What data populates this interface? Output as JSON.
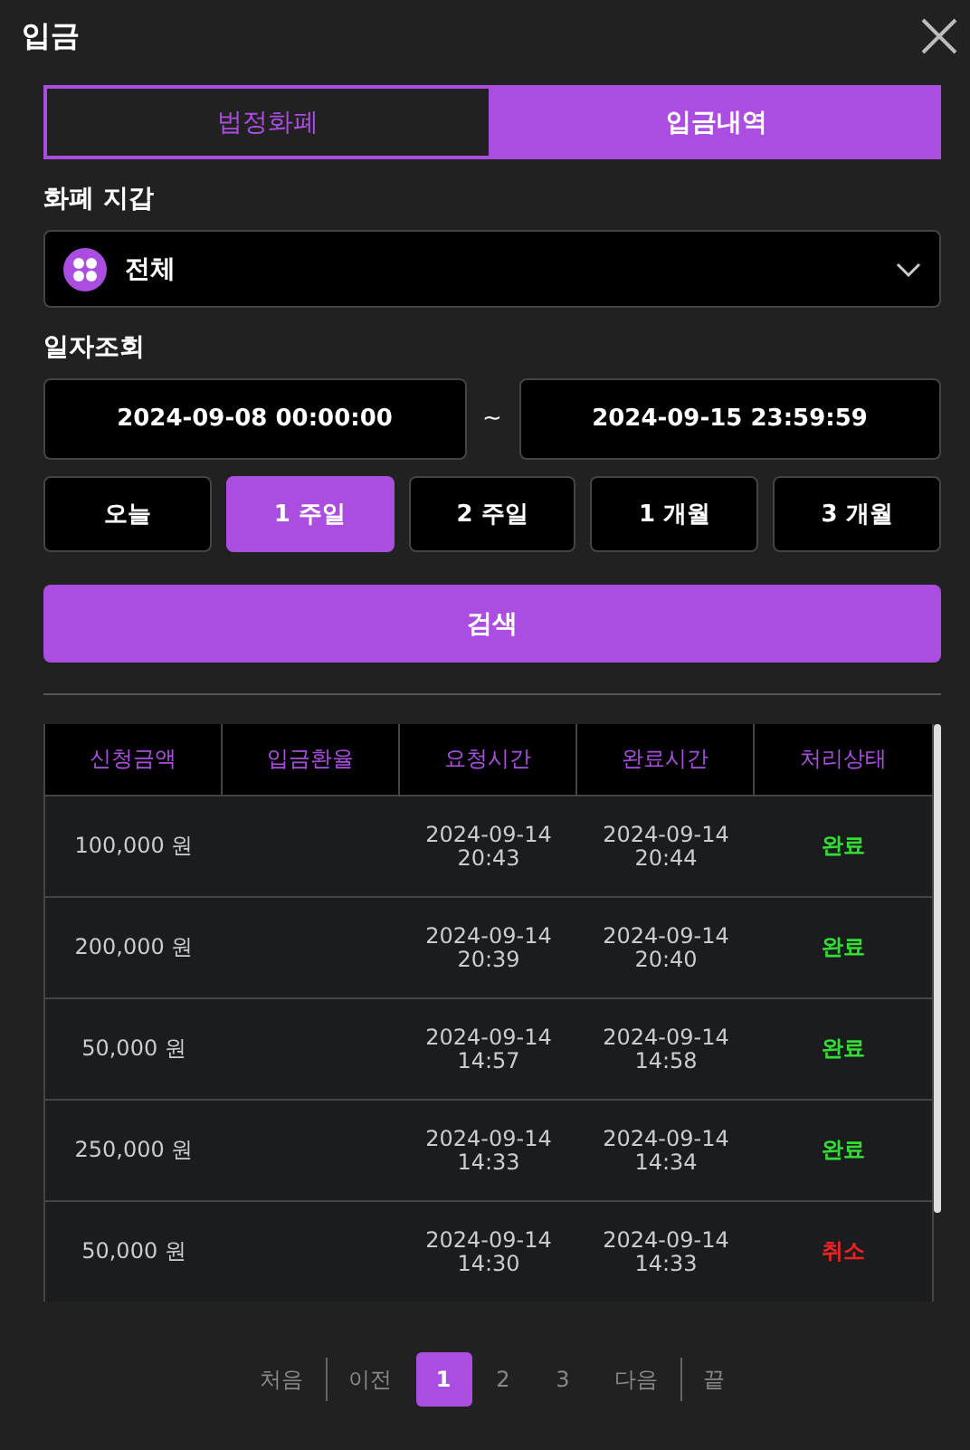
{
  "window": {
    "title": "입금"
  },
  "tabs": [
    {
      "label": "법정화폐",
      "selected": false
    },
    {
      "label": "입금내역",
      "selected": true
    }
  ],
  "wallet": {
    "label": "화폐 지갑",
    "value": "전체"
  },
  "date_filter": {
    "label": "일자조회",
    "from": "2024-09-08 00:00:00",
    "separator": "~",
    "to": "2024-09-15 23:59:59"
  },
  "periods": [
    {
      "label": "오늘",
      "selected": false
    },
    {
      "label": "1 주일",
      "selected": true
    },
    {
      "label": "2 주일",
      "selected": false
    },
    {
      "label": "1 개월",
      "selected": false
    },
    {
      "label": "3 개월",
      "selected": false
    }
  ],
  "search_button": "검색",
  "table": {
    "columns": [
      "신청금액",
      "입금환율",
      "요청시간",
      "완료시간",
      "처리상태"
    ],
    "rows": [
      {
        "amount": "100,000 원",
        "requested": [
          "2024-09-14",
          "20:43"
        ],
        "completed": [
          "2024-09-14",
          "20:44"
        ],
        "status": "완료",
        "color": "#33dd33"
      },
      {
        "amount": "200,000 원",
        "requested": [
          "2024-09-14",
          "20:39"
        ],
        "completed": [
          "2024-09-14",
          "20:40"
        ],
        "status": "완료",
        "color": "#33dd33"
      },
      {
        "amount": "50,000 원",
        "requested": [
          "2024-09-14",
          "14:57"
        ],
        "completed": [
          "2024-09-14",
          "14:58"
        ],
        "status": "완료",
        "color": "#33dd33"
      },
      {
        "amount": "250,000 원",
        "requested": [
          "2024-09-14",
          "14:33"
        ],
        "completed": [
          "2024-09-14",
          "14:34"
        ],
        "status": "완료",
        "color": "#33dd33"
      },
      {
        "amount": "50,000 원",
        "requested": [
          "2024-09-14",
          "14:30"
        ],
        "completed": [
          "2024-09-14",
          "14:33"
        ],
        "status": "취소",
        "color": "#ee2222"
      }
    ]
  },
  "pagination": {
    "first": "처음",
    "prev": "이전",
    "pages": [
      {
        "label": "1",
        "selected": true
      },
      {
        "label": "2",
        "selected": false
      },
      {
        "label": "3",
        "selected": false
      }
    ],
    "next": "다음",
    "last": "끝"
  }
}
